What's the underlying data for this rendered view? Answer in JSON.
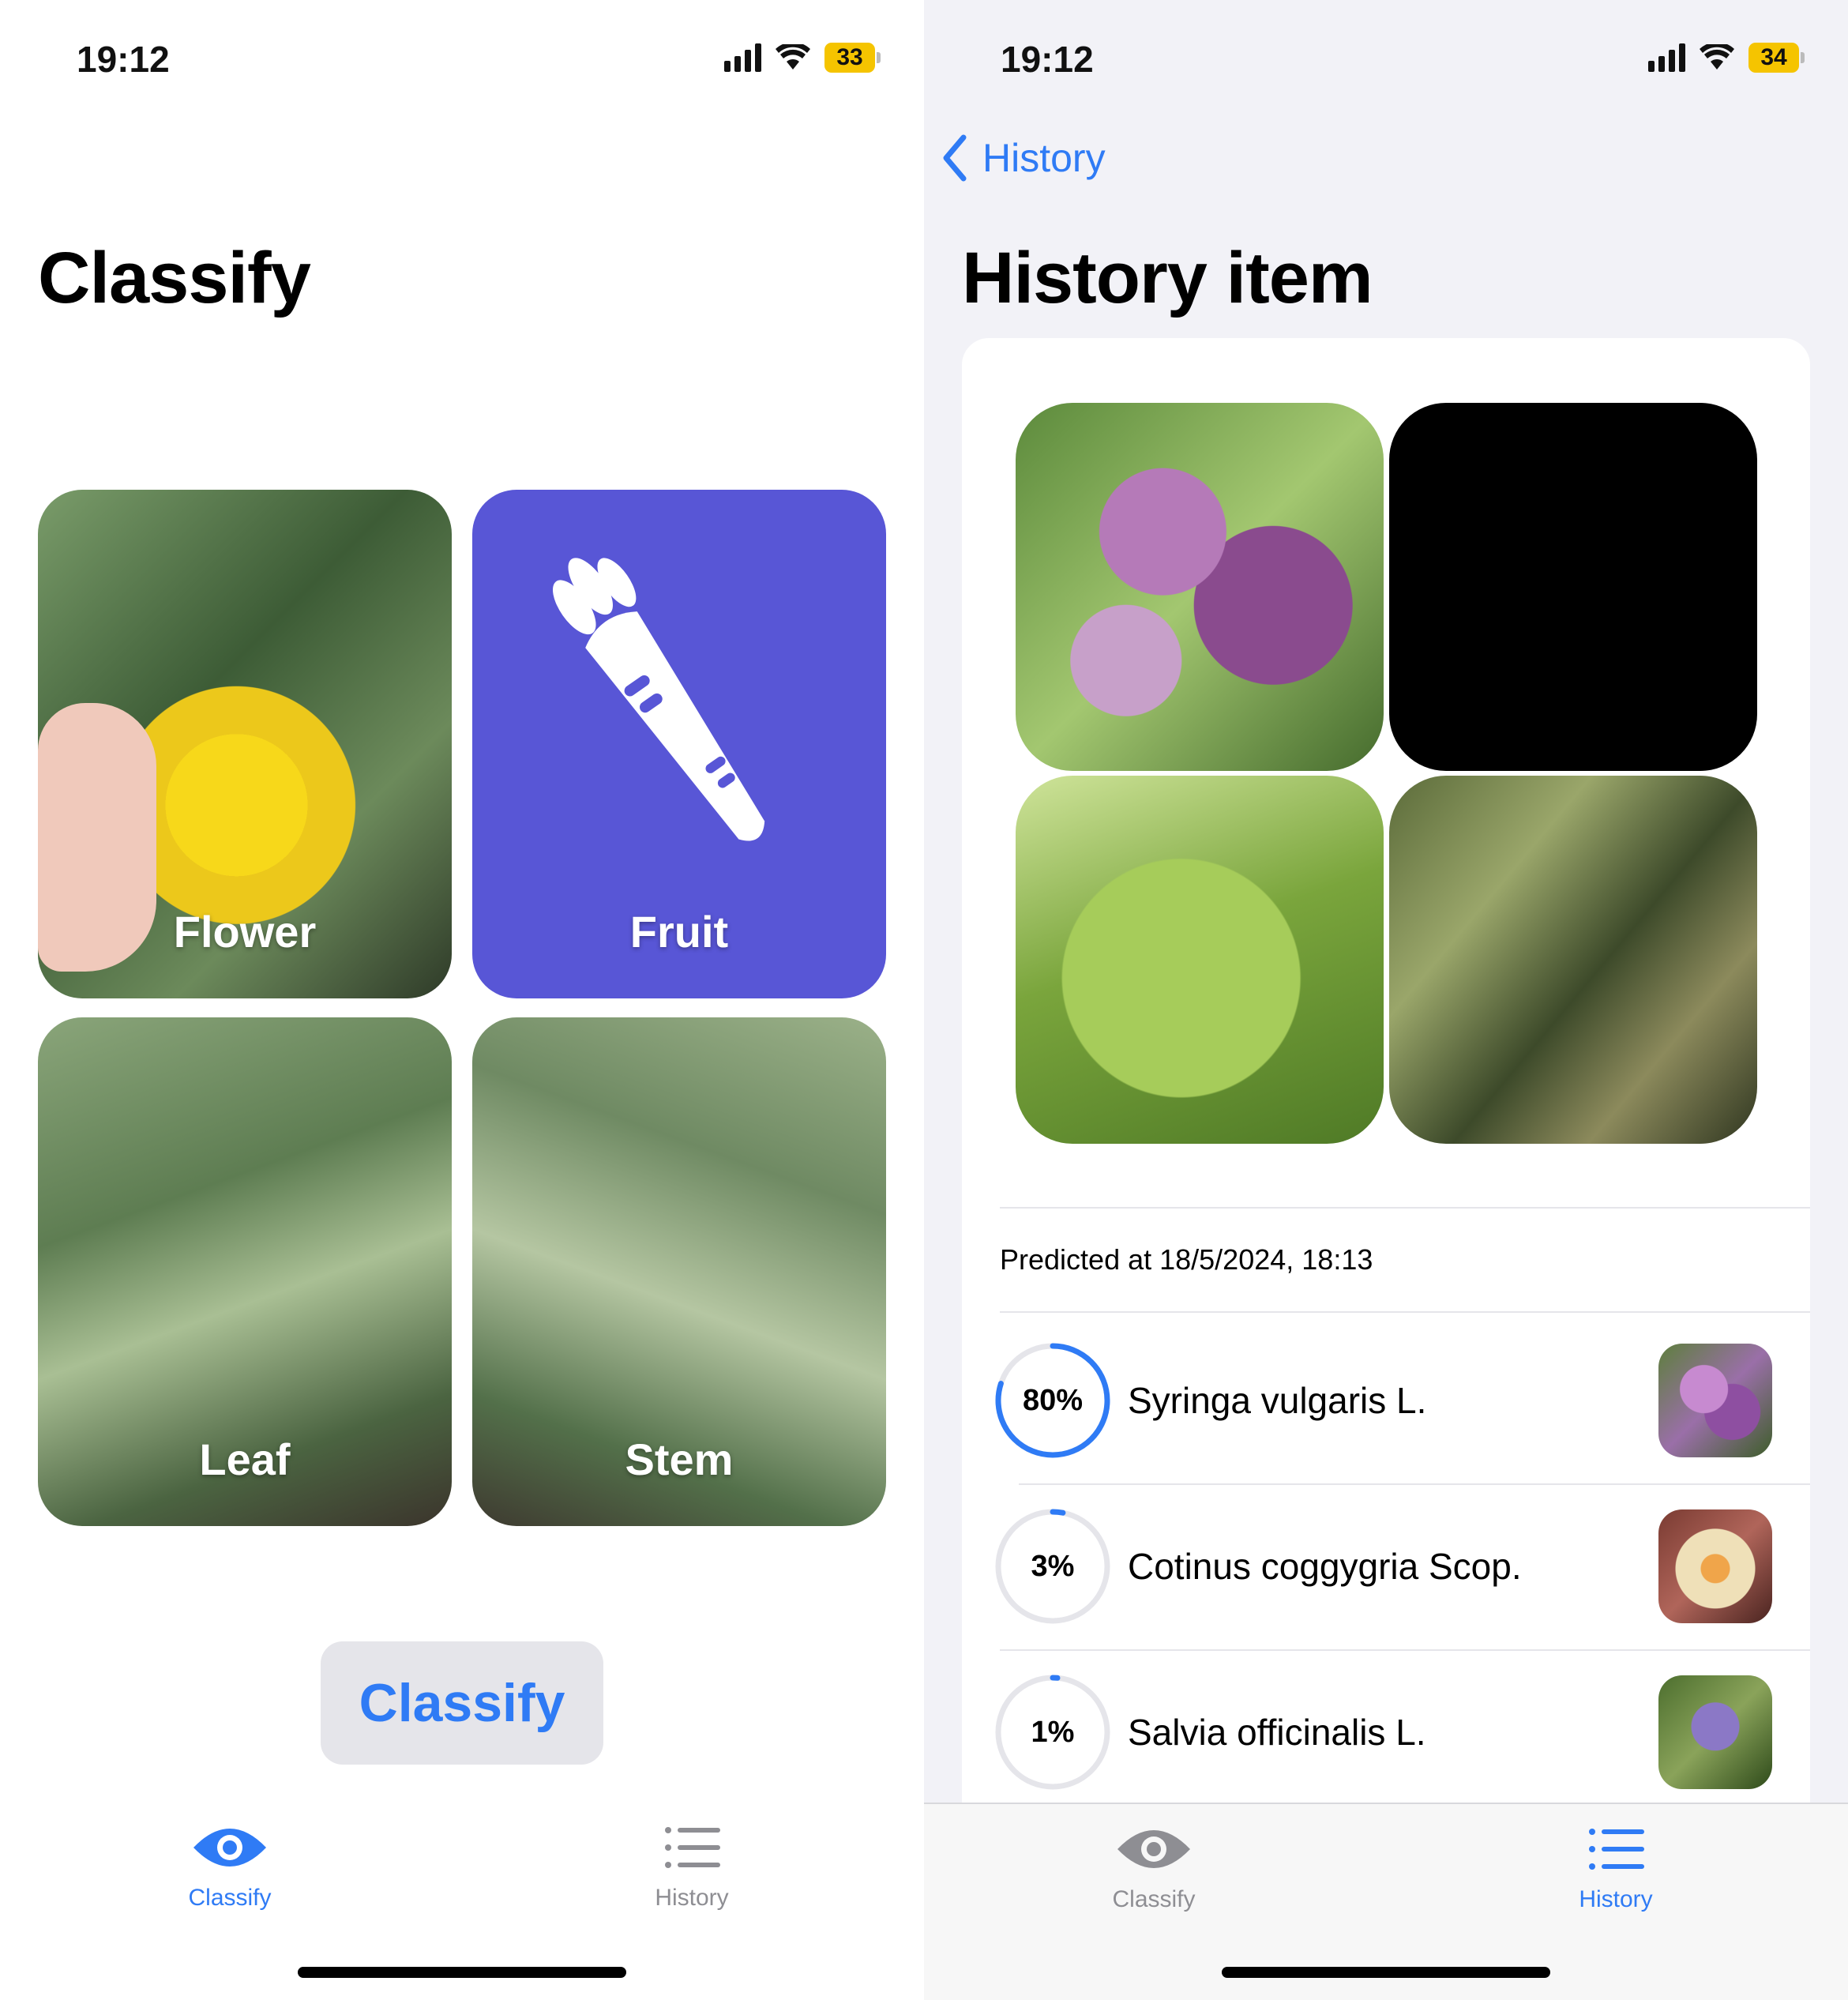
{
  "left": {
    "status": {
      "time": "19:12",
      "battery": "33"
    },
    "title": "Classify",
    "tiles": [
      {
        "label": "Flower"
      },
      {
        "label": "Fruit",
        "color": "#5856d6",
        "icon": "carrot-icon"
      },
      {
        "label": "Leaf"
      },
      {
        "label": "Stem"
      }
    ],
    "classify_button": "Classify",
    "tabs": [
      {
        "label": "Classify",
        "icon": "eye-icon",
        "active": true
      },
      {
        "label": "History",
        "icon": "list-icon",
        "active": false
      }
    ]
  },
  "right": {
    "status": {
      "time": "19:12",
      "battery": "34"
    },
    "back_label": "History",
    "title": "History item",
    "predicted": "Predicted at 18/5/2024, 18:13",
    "predictions": [
      {
        "percent": "80%",
        "value": 0.8,
        "name": "Syringa vulgaris L."
      },
      {
        "percent": "3%",
        "value": 0.03,
        "name": "Cotinus coggygria Scop."
      },
      {
        "percent": "1%",
        "value": 0.01,
        "name": "Salvia officinalis L."
      }
    ],
    "tabs": [
      {
        "label": "Classify",
        "icon": "eye-icon",
        "active": false
      },
      {
        "label": "History",
        "icon": "list-icon",
        "active": true
      }
    ]
  },
  "colors": {
    "accent": "#2f7bf5",
    "fruit_tile": "#5856d6",
    "battery": "#f5c400"
  }
}
